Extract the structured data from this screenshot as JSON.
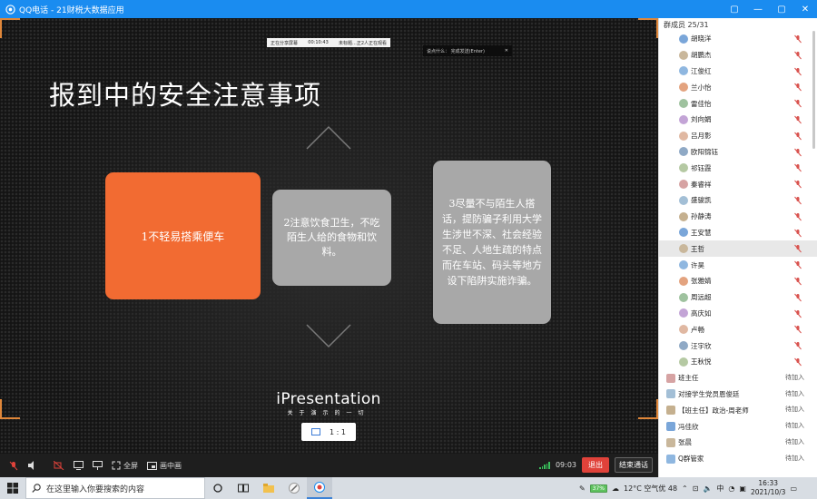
{
  "window": {
    "title": "QQ电话 - 21财税大数据应用",
    "buttons": [
      "▢",
      "—",
      "▢",
      "✕"
    ]
  },
  "share_bar": {
    "status": "正在分享屏幕",
    "time": "00:10:43",
    "info": "未标题...正2人正在观看"
  },
  "comment_bar": {
    "label": "说点什么：  完成发送(Enter)",
    "close": "✕"
  },
  "slide": {
    "title": "报到中的安全注意事项",
    "cards": [
      {
        "text": "1不轻易搭乘便车",
        "color": "#f26b32"
      },
      {
        "text": "2注意饮食卫生，不吃陌生人给的食物和饮料。",
        "color": "#a8a8a8"
      },
      {
        "text": "3尽量不与陌生人搭话，提防骗子利用大学生涉世不深、社会经验不足、人地生疏的特点而在车站、码头等地方设下陷阱实施诈骗。",
        "color": "#a8a8a8"
      }
    ],
    "brand_name": "iPresentation",
    "brand_tag": "关于演示的一切",
    "ratio": "1 : 1"
  },
  "controlbar": {
    "fullscreen": "全屏",
    "pip": "画中画",
    "time": "09:03",
    "exit": "退出",
    "end_call": "结束通话"
  },
  "members": {
    "header": "群成员  25/31",
    "list": [
      {
        "name": "胡晓洋",
        "type": "muted"
      },
      {
        "name": "胡鹏杰",
        "type": "muted"
      },
      {
        "name": "江俊红",
        "type": "muted"
      },
      {
        "name": "兰小怡",
        "type": "muted"
      },
      {
        "name": "雷佳怡",
        "type": "muted"
      },
      {
        "name": "刘向娟",
        "type": "muted"
      },
      {
        "name": "吕月影",
        "type": "muted"
      },
      {
        "name": "欧阳锦钰",
        "type": "muted"
      },
      {
        "name": "祁钰霞",
        "type": "muted"
      },
      {
        "name": "秦睿祥",
        "type": "muted"
      },
      {
        "name": "盛骏凯",
        "type": "muted"
      },
      {
        "name": "孙静涛",
        "type": "muted"
      },
      {
        "name": "王安慧",
        "type": "muted"
      },
      {
        "name": "王哲",
        "type": "muted",
        "selected": true
      },
      {
        "name": "许昊",
        "type": "muted"
      },
      {
        "name": "张雅婧",
        "type": "muted"
      },
      {
        "name": "周远超",
        "type": "muted"
      },
      {
        "name": "高庆如",
        "type": "muted"
      },
      {
        "name": "卢畅",
        "type": "muted"
      },
      {
        "name": "汪宇欣",
        "type": "muted"
      },
      {
        "name": "王秋悦",
        "type": "muted"
      },
      {
        "name": "班主任",
        "type": "pending",
        "status": "待加入"
      },
      {
        "name": "对接学生党员恩俊廷",
        "type": "pending",
        "status": "待加入"
      },
      {
        "name": "【班主任】政治-周老师",
        "type": "pending",
        "status": "待加入"
      },
      {
        "name": "冯佳欣",
        "type": "pending",
        "status": "待加入"
      },
      {
        "name": "张晨",
        "type": "pending",
        "status": "待加入"
      },
      {
        "name": "Q群管家",
        "type": "pending",
        "status": "待加入"
      }
    ]
  },
  "taskbar": {
    "search_placeholder": "在这里输入你要搜索的内容",
    "battery": "37%",
    "weather": "12°C  空气优 48",
    "time": "16:33",
    "date": "2021/10/3"
  },
  "colors": {
    "titlebar": "#1a8cf0",
    "accent_orange": "#f26b32",
    "card_gray": "#a8a8a8",
    "exit_red": "#e0423a",
    "muted_red": "#d9534f"
  }
}
